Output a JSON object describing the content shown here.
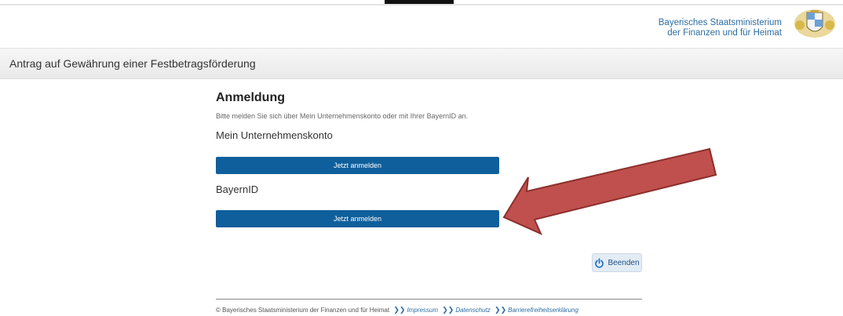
{
  "header": {
    "brand_line1": "Bayerisches Staatsministerium",
    "brand_line2": "der Finanzen und für Heimat"
  },
  "title_bar": {
    "title": "Antrag auf Gewährung einer Festbetragsförderung"
  },
  "main": {
    "heading": "Anmeldung",
    "intro": "Bitte melden Sie sich über Mein Unternehmenskonto oder mit Ihrer BayernID an.",
    "section1": {
      "heading": "Mein Unternehmenskonto",
      "button": "Jetzt anmelden"
    },
    "section2": {
      "heading": "BayernID",
      "button": "Jetzt anmelden"
    }
  },
  "actions": {
    "beenden": "Beenden"
  },
  "footer": {
    "copyright": "© Bayerisches Staatsministerium der Finanzen und für Heimat",
    "links": [
      "Impressum",
      "Datenschutz",
      "Barrierefreiheitserklärung"
    ]
  },
  "colors": {
    "primary_button": "#0f5f9c",
    "link": "#2e6da4",
    "arrow_fill": "#c0504d"
  }
}
